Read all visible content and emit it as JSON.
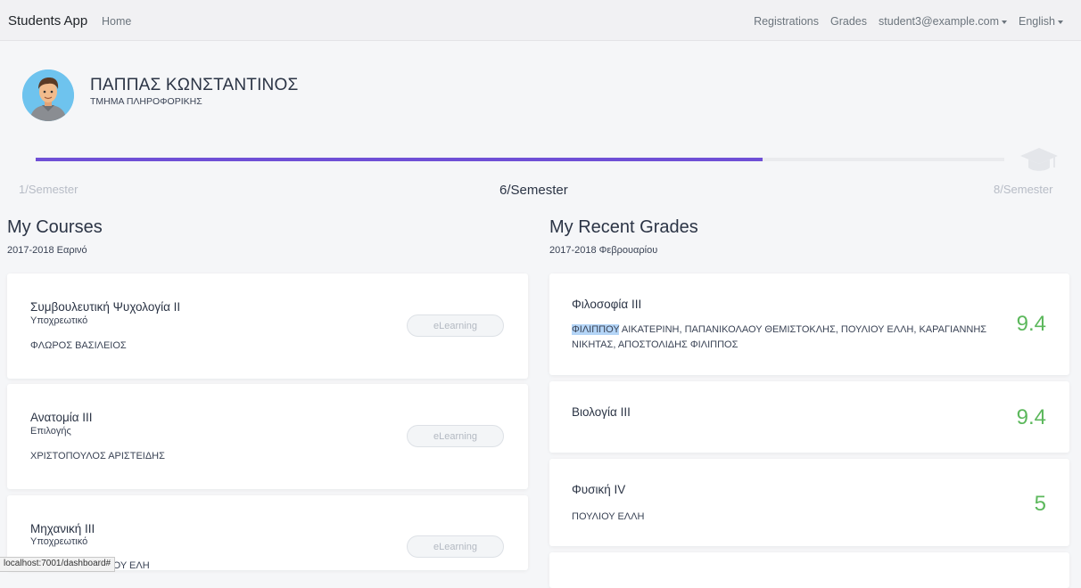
{
  "nav": {
    "brand": "Students App",
    "home": "Home",
    "registrations": "Registrations",
    "grades": "Grades",
    "user": "student3@example.com",
    "language": "English"
  },
  "profile": {
    "name": "ΠΑΠΠΑΣ ΚΩΝΣΤΑΝΤΙΝΟΣ",
    "department": "ΤΜΗΜΑ ΠΛΗΡΟΦΟΡΙΚΗΣ"
  },
  "progress": {
    "start_label": "1/Semester",
    "current_label": "6/Semester",
    "end_label": "8/Semester",
    "fraction": 0.75,
    "fill_color": "#6f4fd6"
  },
  "courses": {
    "title": "My Courses",
    "period": "2017-2018 Εαρινό",
    "items": [
      {
        "title": "Συμβουλευτική Ψυχολογία ΙΙ",
        "type": "Υποχρεωτικό",
        "instructor": "ΦΛΩΡΟΣ ΒΑΣΙΛΕΙΟΣ",
        "button": "eLearning"
      },
      {
        "title": "Ανατομία ΙΙΙ",
        "type": "Επιλογής",
        "instructor": "ΧΡΙΣΤΟΠΟΥΛΟΣ ΑΡΙΣΤΕΙΔΗΣ",
        "button": "eLearning"
      },
      {
        "title": "Μηχανική ΙΙΙ",
        "type": "Υποχρεωτικό",
        "instructor": "ΦΙΛΙΠΠΟΣ, ΠΟΥΛΙΟΥ ΕΛΗ",
        "button": "eLearning"
      }
    ]
  },
  "grades": {
    "title": "My Recent Grades",
    "period": "2017-2018 Φεβρουαρίου",
    "grade_color": "#5cb85c",
    "items": [
      {
        "title": "Φιλοσοφία ΙΙΙ",
        "profs_highlight": "ΦΙΛΙΠΠΟΥ",
        "profs_rest": " ΑΙΚΑΤΕΡΙΝΗ, ΠΑΠΑΝΙΚΟΛΑΟΥ ΘΕΜΙΣΤΟΚΛΗΣ, ΠΟΥΛΙΟΥ ΕΛΛΗ, ΚΑΡΑΓΙΑΝΝΗΣ ΝΙΚΗΤΑΣ, ΑΠΟΣΤΟΛΙΔΗΣ ΦΙΛΙΠΠΟΣ",
        "grade": "9.4"
      },
      {
        "title": "Βιολογία ΙΙΙ",
        "profs_highlight": "",
        "profs_rest": "",
        "grade": "9.4"
      },
      {
        "title": "Φυσική IV",
        "profs_highlight": "",
        "profs_rest": "ΠΟΥΛΙΟΥ ΕΛΛΗ",
        "grade": "5"
      }
    ]
  },
  "status_bar": {
    "url": "localhost:7001/dashboard#"
  },
  "icons": {
    "avatar": "student-avatar",
    "graduation": "graduation-cap-icon",
    "dropdown": "caret-down-icon"
  }
}
